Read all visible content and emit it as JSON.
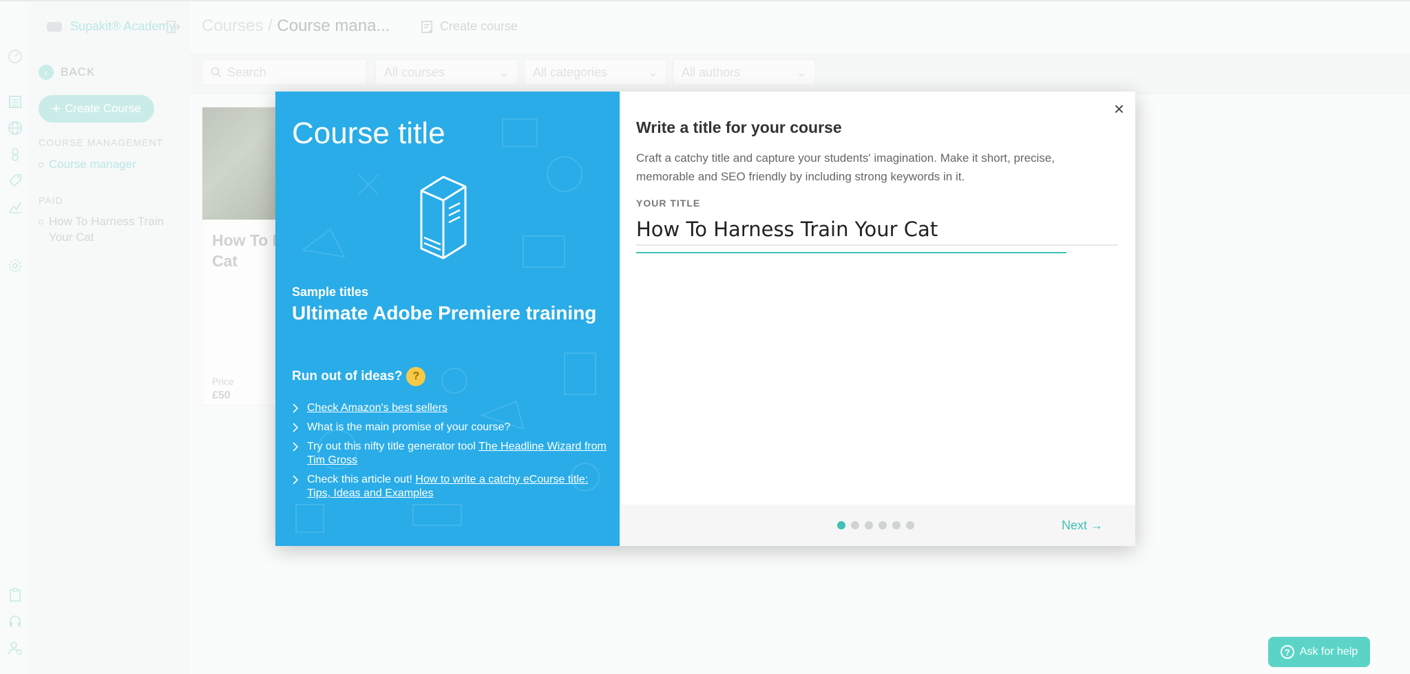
{
  "app": {
    "brand": "Supakit® Academy"
  },
  "colors": {
    "accent": "#41c1b6",
    "modal_left_bg": "#29ace8",
    "help_button": "#5bd4c7"
  },
  "header": {
    "breadcrumb_root": "Courses",
    "breadcrumb_sep": "/",
    "breadcrumb_current": "Course mana...",
    "create_course": "Create course"
  },
  "sidebar": {
    "back_label": "BACK",
    "create_course_label": "Create Course",
    "section_management": "COURSE MANAGEMENT",
    "course_manager_link": "Course manager",
    "section_paid": "PAID",
    "paid_course": "How To Harness Train Your Cat",
    "rail_icons": [
      "dashboard-icon",
      "courses-icon",
      "globe-icon",
      "users-icon",
      "tag-icon",
      "analytics-icon",
      "settings-icon",
      "clipboard-icon",
      "support-icon",
      "user-settings-icon"
    ]
  },
  "filters": {
    "search_placeholder": "Search",
    "courses": "All courses",
    "categories": "All categories",
    "authors": "All authors"
  },
  "card": {
    "title": "How To I Cat",
    "price_label": "Price",
    "price_value": "£50"
  },
  "modal": {
    "left": {
      "title": "Course title",
      "sample_label": "Sample titles",
      "sample_value": "Ultimate Adobe Premiere training",
      "ideas_heading": "Run out of ideas?",
      "ideas": [
        {
          "text": "",
          "link": "Check Amazon's best sellers"
        },
        {
          "text": "What is the main promise of your course?",
          "link": ""
        },
        {
          "text": "Try out this nifty title generator tool ",
          "link": "The Headline Wizard from Tim Gross"
        },
        {
          "text": "Check this article out! ",
          "link": "How to write a catchy eCourse title: Tips, Ideas and Examples"
        }
      ]
    },
    "right": {
      "close_label": "×",
      "title": "Write a title for your course",
      "description": "Craft a catchy title and capture your students' imagination. Make it short, precise, memorable and SEO friendly by including strong keywords in it.",
      "field_label": "YOUR TITLE",
      "field_value": "How To Harness Train Your Cat",
      "step_current": 1,
      "step_total": 6,
      "next_label": "Next →"
    }
  },
  "help": {
    "label": "Ask for help"
  }
}
